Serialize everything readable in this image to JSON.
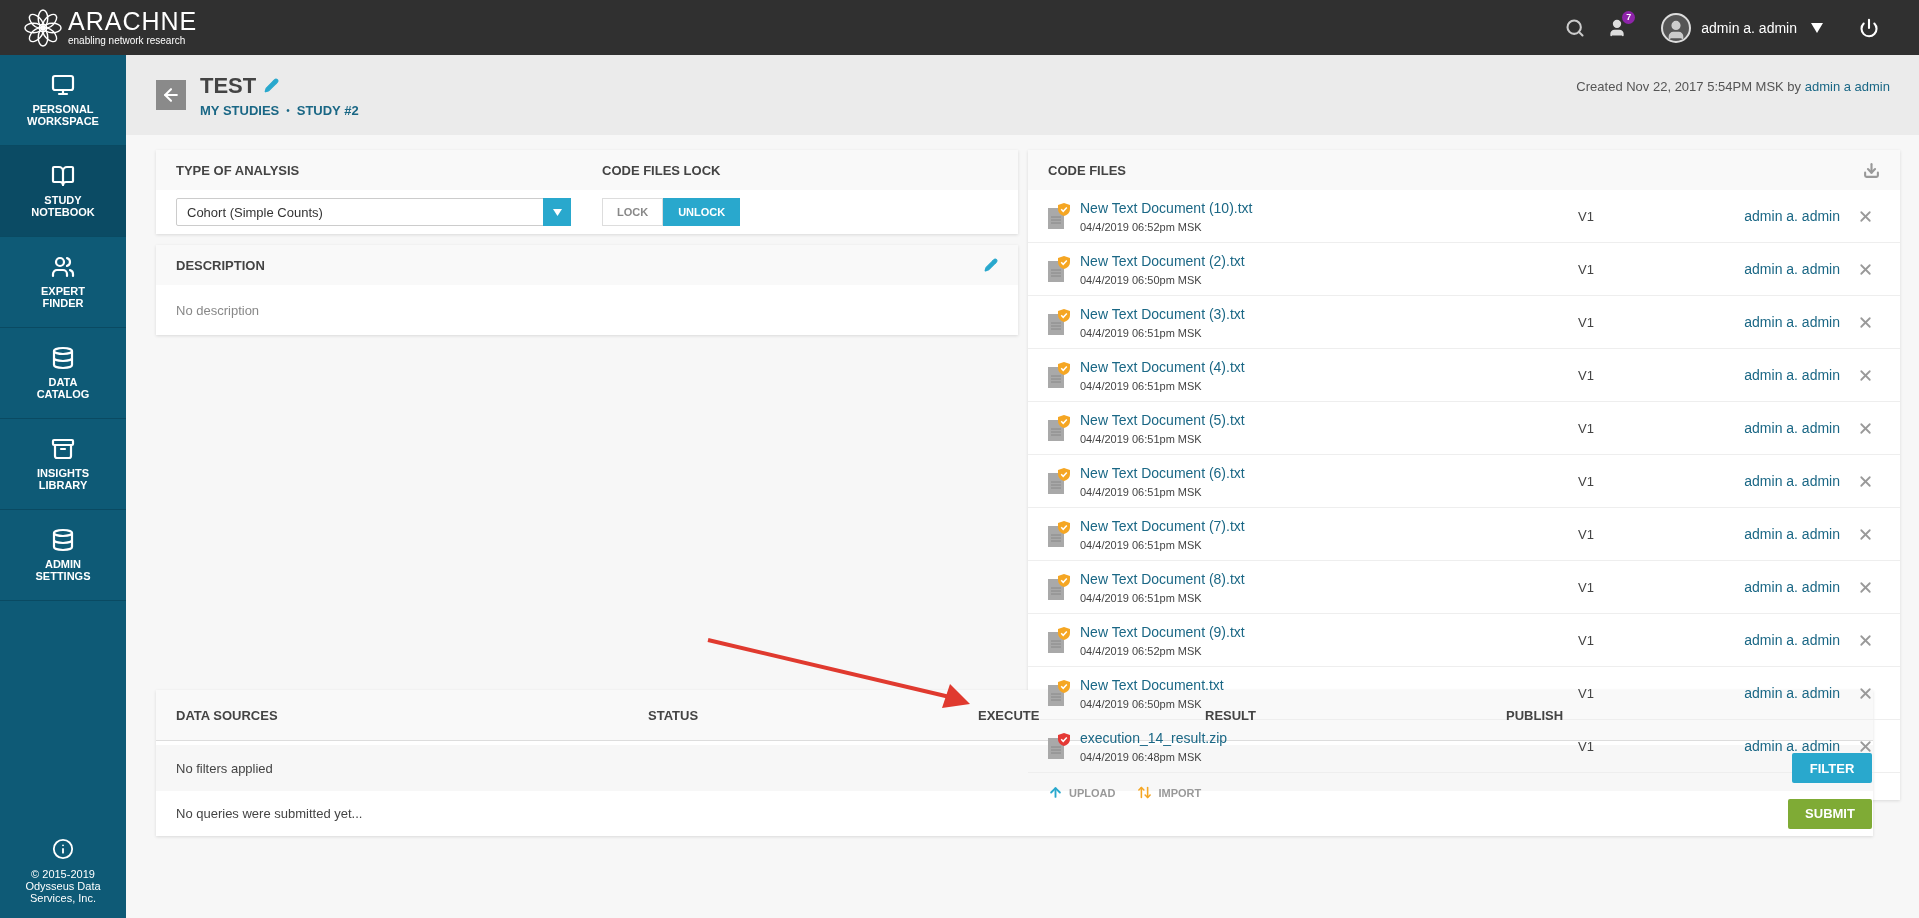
{
  "brand": {
    "name": "ARACHNE",
    "tagline": "enabling network research"
  },
  "top_bar": {
    "notification_count": "7",
    "user": "admin a. admin"
  },
  "sidebar": {
    "items": [
      {
        "label": "PERSONAL WORKSPACE",
        "selected": false
      },
      {
        "label": "STUDY NOTEBOOK",
        "selected": true
      },
      {
        "label": "EXPERT FINDER",
        "selected": false
      },
      {
        "label": "DATA CATALOG",
        "selected": false
      },
      {
        "label": "INSIGHTS LIBRARY",
        "selected": false
      },
      {
        "label": "ADMIN SETTINGS",
        "selected": false
      }
    ],
    "footer": "© 2015-2019 Odysseus Data Services, Inc."
  },
  "header": {
    "title": "TEST",
    "breadcrumbs": [
      "MY STUDIES",
      "STUDY #2"
    ],
    "separator": "•",
    "created": "Created Nov 22, 2017 5:54PM MSK by",
    "author": "admin a admin"
  },
  "analysis": {
    "type_label": "TYPE OF ANALYSIS",
    "type_value": "Cohort (Simple Counts)",
    "lock_label": "CODE FILES LOCK",
    "lock_options": [
      {
        "label": "LOCK",
        "selected": false
      },
      {
        "label": "UNLOCK",
        "selected": true
      }
    ]
  },
  "description": {
    "title": "DESCRIPTION",
    "text": "No description"
  },
  "code_files": {
    "title": "CODE FILES",
    "files": [
      {
        "name": "New Text Document (10).txt",
        "date": "04/4/2019 06:52pm MSK",
        "version": "V1",
        "author": "admin a. admin",
        "color": "#f5a623"
      },
      {
        "name": "New Text Document (2).txt",
        "date": "04/4/2019 06:50pm MSK",
        "version": "V1",
        "author": "admin a. admin",
        "color": "#f5a623"
      },
      {
        "name": "New Text Document (3).txt",
        "date": "04/4/2019 06:51pm MSK",
        "version": "V1",
        "author": "admin a. admin",
        "color": "#f5a623"
      },
      {
        "name": "New Text Document (4).txt",
        "date": "04/4/2019 06:51pm MSK",
        "version": "V1",
        "author": "admin a. admin",
        "color": "#f5a623"
      },
      {
        "name": "New Text Document (5).txt",
        "date": "04/4/2019 06:51pm MSK",
        "version": "V1",
        "author": "admin a. admin",
        "color": "#f5a623"
      },
      {
        "name": "New Text Document (6).txt",
        "date": "04/4/2019 06:51pm MSK",
        "version": "V1",
        "author": "admin a. admin",
        "color": "#f5a623"
      },
      {
        "name": "New Text Document (7).txt",
        "date": "04/4/2019 06:51pm MSK",
        "version": "V1",
        "author": "admin a. admin",
        "color": "#f5a623"
      },
      {
        "name": "New Text Document (8).txt",
        "date": "04/4/2019 06:51pm MSK",
        "version": "V1",
        "author": "admin a. admin",
        "color": "#f5a623"
      },
      {
        "name": "New Text Document (9).txt",
        "date": "04/4/2019 06:52pm MSK",
        "version": "V1",
        "author": "admin a. admin",
        "color": "#f5a623"
      },
      {
        "name": "New Text Document.txt",
        "date": "04/4/2019 06:50pm MSK",
        "version": "V1",
        "author": "admin a. admin",
        "color": "#f5a623"
      },
      {
        "name": "execution_14_result.zip",
        "date": "04/4/2019 06:48pm MSK",
        "version": "V1",
        "author": "admin a. admin",
        "color": "#e53935"
      }
    ],
    "actions": [
      "UPLOAD",
      "IMPORT"
    ]
  },
  "data_sources": {
    "columns": [
      "DATA SOURCES",
      "STATUS",
      "EXECUTE",
      "RESULT",
      "PUBLISH"
    ],
    "filter_text": "No filters applied",
    "filter_button": "FILTER",
    "empty_text": "No queries were submitted yet...",
    "submit_button": "SUBMIT"
  }
}
